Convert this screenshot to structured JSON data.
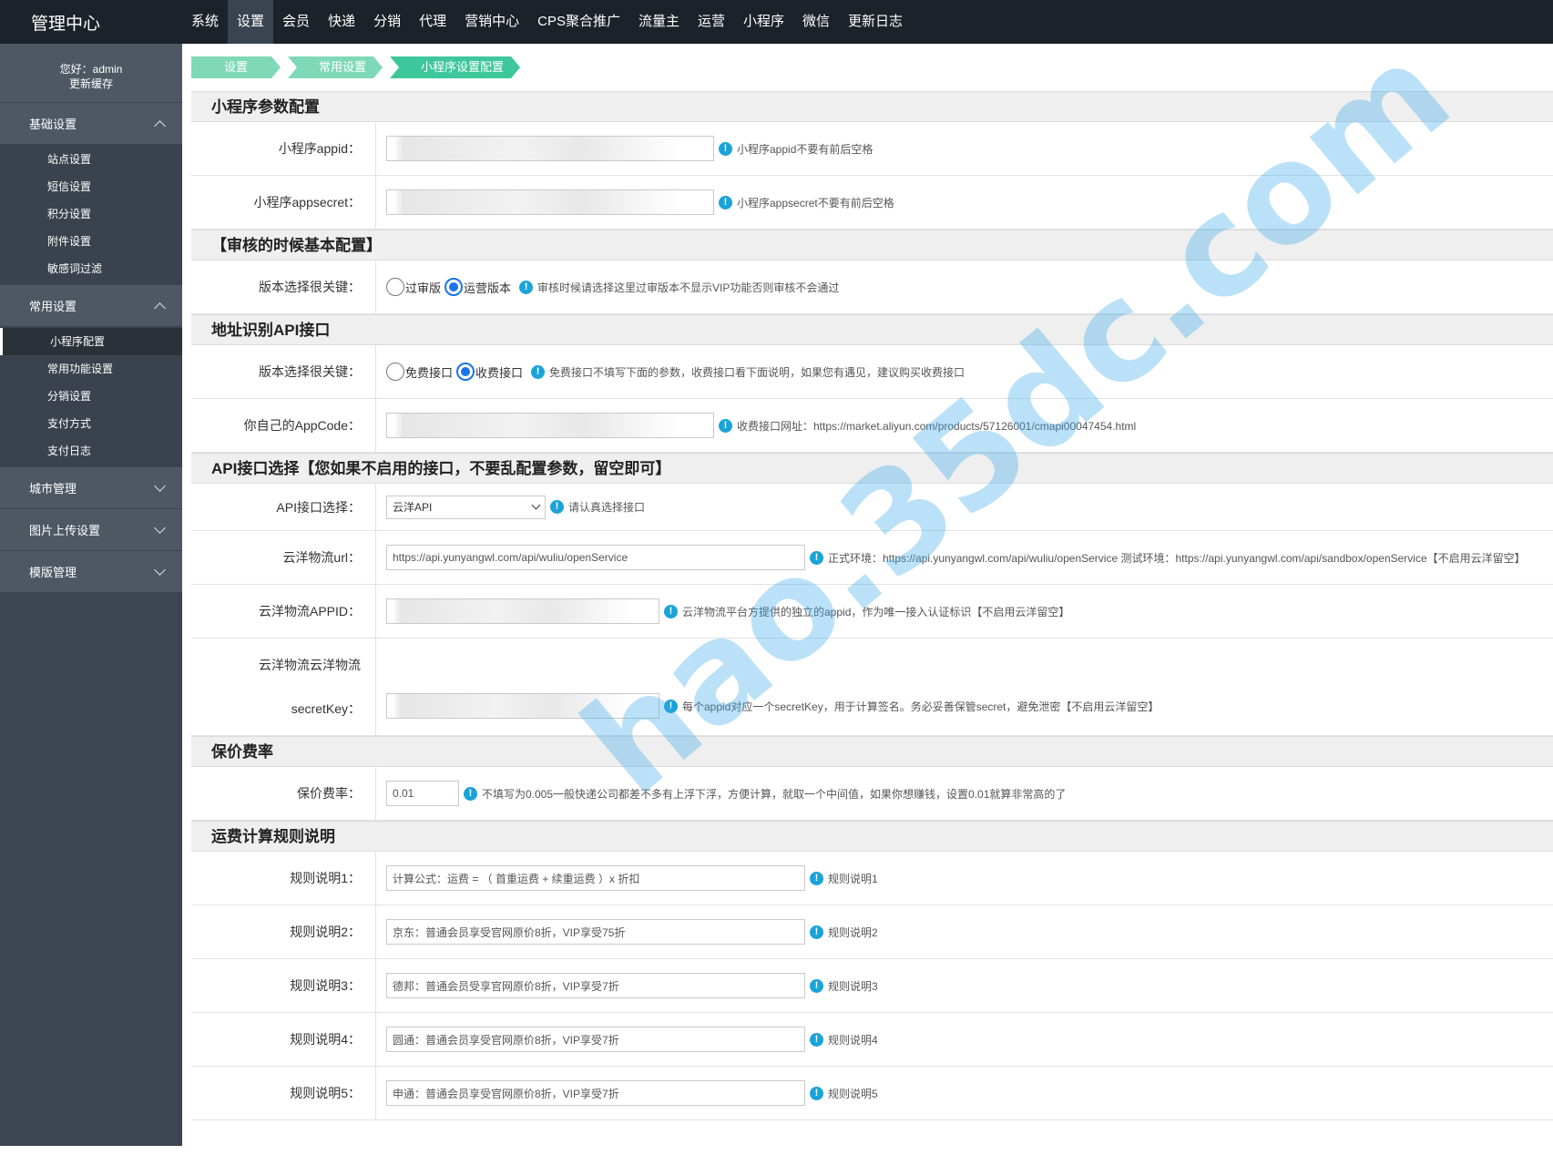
{
  "app": {
    "title": "管理中心"
  },
  "topnav": [
    "系统",
    "设置",
    "会员",
    "快递",
    "分销",
    "代理",
    "营销中心",
    "CPS聚合推广",
    "流量主",
    "运营",
    "小程序",
    "微信",
    "更新日志"
  ],
  "user": {
    "greeting": "您好：admin",
    "refresh": "更新缓存"
  },
  "sidebar": {
    "basic": {
      "label": "基础设置",
      "items": [
        "站点设置",
        "短信设置",
        "积分设置",
        "附件设置",
        "敏感词过滤"
      ]
    },
    "common": {
      "label": "常用设置",
      "items": [
        "小程序配置",
        "常用功能设置",
        "分销设置",
        "支付方式",
        "支付日志"
      ]
    },
    "city": "城市管理",
    "upload": "图片上传设置",
    "template": "模版管理"
  },
  "breadcrumb": [
    "设置",
    "常用设置",
    "小程序设置配置"
  ],
  "sections": {
    "mini": {
      "title": "小程序参数配置",
      "appid_label": "小程序appid：",
      "appid_tip": "小程序appid不要有前后空格",
      "secret_label": "小程序appsecret：",
      "secret_tip": "小程序appsecret不要有前后空格"
    },
    "audit": {
      "title": "【审核的时候基本配置】",
      "label": "版本选择很关键：",
      "opt1": "过审版",
      "opt2": "运营版本",
      "tip": "审核时候请选择这里过审版本不显示VIP功能否则审核不会通过"
    },
    "addr": {
      "title": "地址识别API接口",
      "label": "版本选择很关键：",
      "opt1": "免费接口",
      "opt2": "收费接口",
      "tip": "免费接口不填写下面的参数，收费接口看下面说明，如果您有遇见，建议购买收费接口",
      "appcode_label": "你自己的AppCode：",
      "appcode_tip": "收费接口网址：https://market.aliyun.com/products/57126001/cmapi00047454.html"
    },
    "api": {
      "title": "API接口选择【您如果不启用的接口，不要乱配置参数，留空即可】",
      "select_label": "API接口选择：",
      "select_value": "云洋API",
      "select_tip": "请认真选择接口",
      "url_label": "云洋物流url：",
      "url_value": "https://api.yunyangwl.com/api/wuliu/openService",
      "url_tip": "正式环境：https://api.yunyangwl.com/api/wuliu/openService 测试环境：https://api.yunyangwl.com/api/sandbox/openService【不启用云洋留空】",
      "appid_label": "云洋物流APPID：",
      "appid_tip": "云洋物流平台方提供的独立的appid，作为唯一接入认证标识【不启用云洋留空】",
      "secret_label1": "云洋物流云洋物流",
      "secret_label2": "secretKey：",
      "secret_tip": "每个appid对应一个secretKey，用于计算签名。务必妥善保管secret，避免泄密【不启用云洋留空】"
    },
    "insure": {
      "title": "保价费率",
      "label": "保价费率：",
      "value": "0.01",
      "tip": "不填写为0.005一般快递公司都差不多有上浮下浮，方便计算，就取一个中间值，如果你想赚钱，设置0.01就算非常高的了"
    },
    "rules": {
      "title": "运费计算规则说明",
      "items": [
        {
          "label": "规则说明1：",
          "value": "计算公式：运费 = （ 首重运费 + 续重运费 ）x 折扣",
          "tip": "规则说明1"
        },
        {
          "label": "规则说明2：",
          "value": "京东：普通会员享受官网原价8折，VIP享受75折",
          "tip": "规则说明2"
        },
        {
          "label": "规则说明3：",
          "value": "德邦：普通会员受享官网原价8折，VIP享受7折",
          "tip": "规则说明3"
        },
        {
          "label": "规则说明4：",
          "value": "圆通：普通会员享受官网原价8折，VIP享受7折",
          "tip": "规则说明4"
        },
        {
          "label": "规则说明5：",
          "value": "申通：普通会员享受官网原价8折，VIP享受7折",
          "tip": "规则说明5"
        }
      ]
    }
  },
  "watermark": "hao.35dc.com"
}
